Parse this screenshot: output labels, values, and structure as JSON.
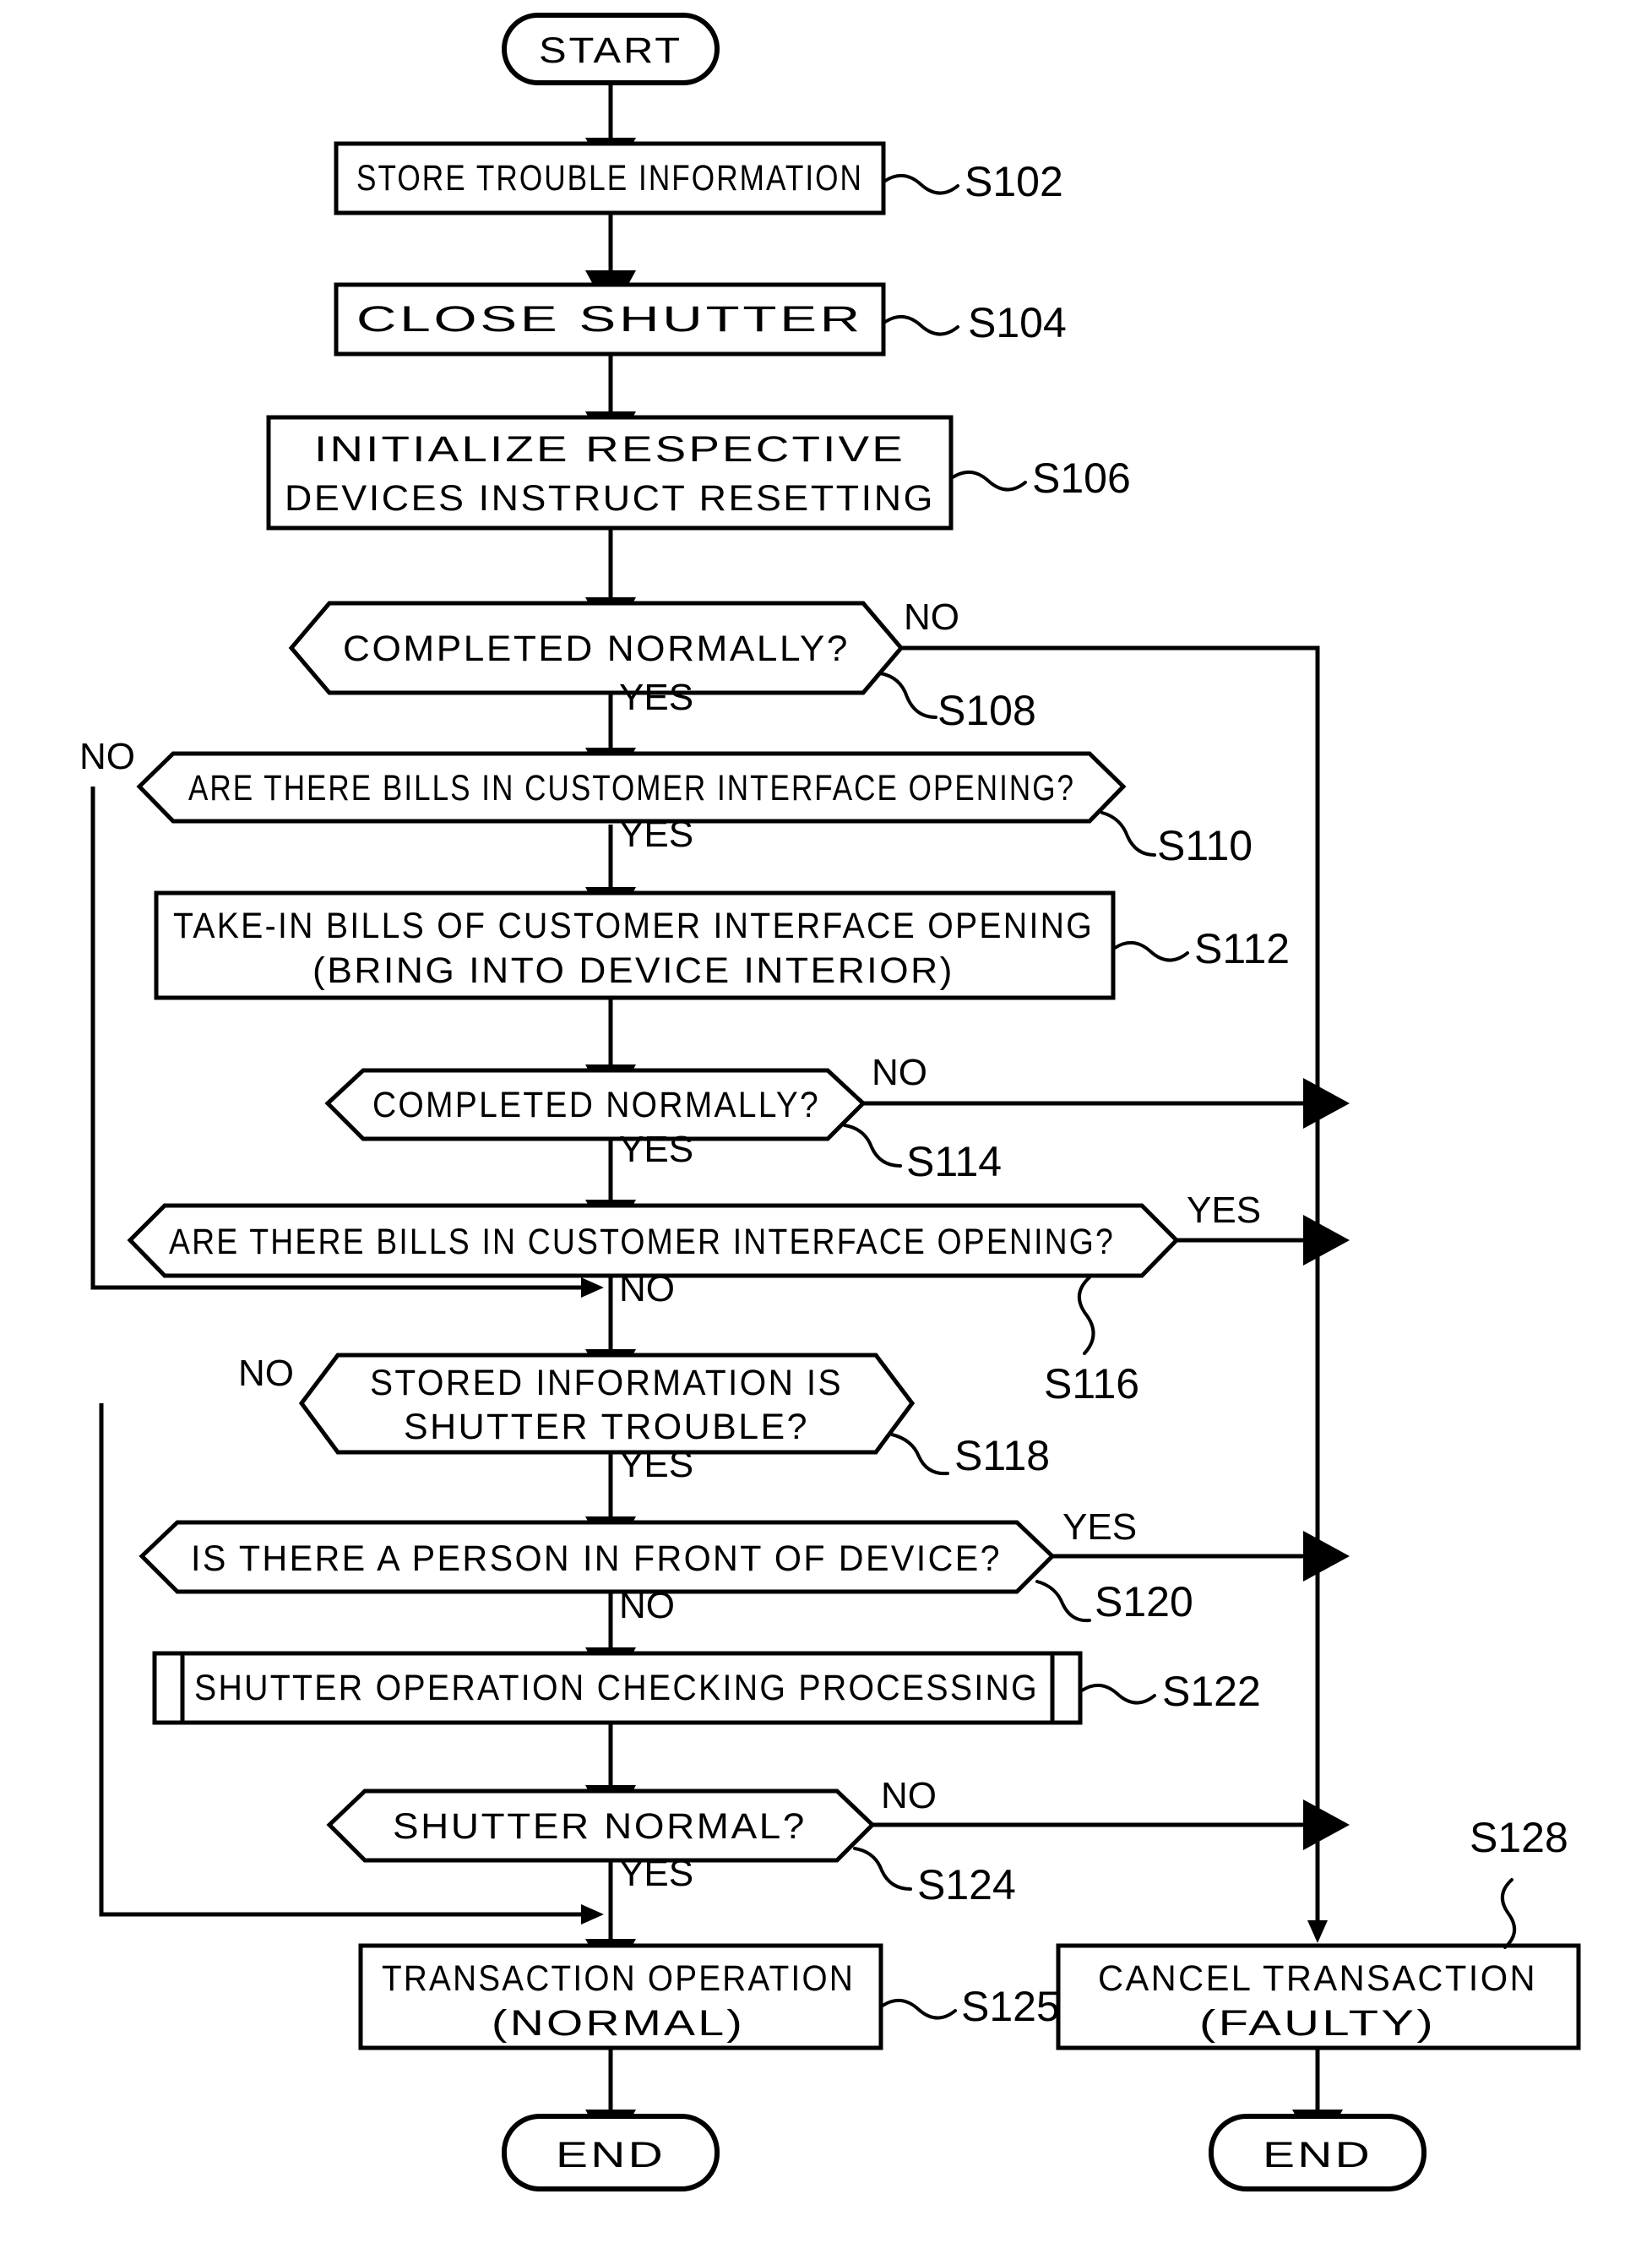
{
  "diagram": {
    "type": "flowchart",
    "title": "",
    "nodes": [
      {
        "id": "start",
        "kind": "terminal",
        "label": "START"
      },
      {
        "id": "s102",
        "kind": "process",
        "label": "STORE TROUBLE INFORMATION",
        "step": "S102"
      },
      {
        "id": "s104",
        "kind": "process",
        "label": "CLOSE SHUTTER",
        "step": "S104"
      },
      {
        "id": "s106",
        "kind": "process",
        "line1": "INITIALIZE RESPECTIVE",
        "line2": "DEVICES INSTRUCT RESETTING",
        "step": "S106"
      },
      {
        "id": "s108",
        "kind": "decision",
        "label": "COMPLETED NORMALLY?",
        "step": "S108",
        "yes": "YES",
        "no": "NO"
      },
      {
        "id": "s110",
        "kind": "decision",
        "label": "ARE THERE BILLS IN CUSTOMER INTERFACE OPENING?",
        "step": "S110",
        "yes": "YES",
        "no": "NO"
      },
      {
        "id": "s112",
        "kind": "process",
        "line1": "TAKE-IN BILLS OF CUSTOMER INTERFACE OPENING",
        "line2": "(BRING INTO DEVICE INTERIOR)",
        "step": "S112"
      },
      {
        "id": "s114",
        "kind": "decision",
        "label": "COMPLETED NORMALLY?",
        "step": "S114",
        "yes": "YES",
        "no": "NO"
      },
      {
        "id": "s116",
        "kind": "decision",
        "label": "ARE THERE BILLS IN CUSTOMER INTERFACE OPENING?",
        "step": "S116",
        "yes": "YES",
        "no": "NO"
      },
      {
        "id": "s118",
        "kind": "decision",
        "line1": "STORED INFORMATION IS",
        "line2": "SHUTTER TROUBLE?",
        "step": "S118",
        "yes": "YES",
        "no": "NO"
      },
      {
        "id": "s120",
        "kind": "decision",
        "label": "IS THERE A PERSON IN FRONT OF DEVICE?",
        "step": "S120",
        "yes": "YES",
        "no": "NO"
      },
      {
        "id": "s122",
        "kind": "predefined-process",
        "label": "SHUTTER OPERATION CHECKING PROCESSING",
        "step": "S122"
      },
      {
        "id": "s124",
        "kind": "decision",
        "label": "SHUTTER NORMAL?",
        "step": "S124",
        "yes": "YES",
        "no": "NO"
      },
      {
        "id": "s125",
        "kind": "process",
        "line1": "TRANSACTION OPERATION",
        "line2": "(NORMAL)",
        "step": "S125"
      },
      {
        "id": "s128",
        "kind": "process",
        "line1": "CANCEL TRANSACTION",
        "line2": "(FAULTY)",
        "step": "S128"
      },
      {
        "id": "end1",
        "kind": "terminal",
        "label": "END"
      },
      {
        "id": "end2",
        "kind": "terminal",
        "label": "END"
      }
    ],
    "step_labels": [
      "S102",
      "S104",
      "S106",
      "S108",
      "S110",
      "S112",
      "S114",
      "S116",
      "S118",
      "S120",
      "S122",
      "S124",
      "S125",
      "S128"
    ],
    "branch_labels": {
      "yes": "YES",
      "no": "NO"
    },
    "colors": {
      "stroke": "#000000",
      "fill": "#ffffff",
      "text": "#000000"
    }
  }
}
